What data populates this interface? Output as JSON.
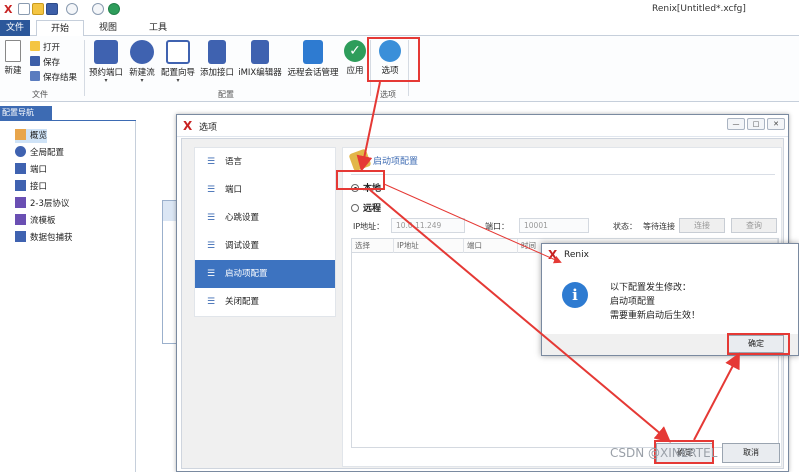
{
  "window": {
    "title": "Renix[Untitled*.xcfg]"
  },
  "ribbon_tabs": [
    "文件",
    "开始",
    "视图",
    "工具"
  ],
  "ribbon": {
    "new_label": "新建",
    "open_label": "打开",
    "save_label": "保存",
    "save_result_label": "保存结果",
    "file_group": "文件",
    "reserve_port": "预约端口",
    "new_flow": "新建流",
    "config_wizard": "配置向导",
    "add_interface": "添加接口",
    "imix_editor": "iMIX编辑器",
    "remote_session": "远程会话管理",
    "apply": "应用",
    "config_group": "配置",
    "options_btn": "选项",
    "options_group": "选项"
  },
  "nav": {
    "header": "配置导航",
    "items": [
      "概览",
      "全局配置",
      "端口",
      "接口",
      "2-3层协议",
      "流模板",
      "数据包捕获"
    ]
  },
  "options_dialog": {
    "title": "选项",
    "list": [
      "语言",
      "端口",
      "心跳设置",
      "调试设置",
      "启动项配置",
      "关闭配置"
    ],
    "panel_title": "启动项配置",
    "radio_local": "本地",
    "radio_remote": "远程",
    "ip_label": "IP地址：",
    "ip_value": "10.0.11.249",
    "port_label": "端口：",
    "port_value": "10001",
    "status_label": "状态：",
    "status_value": "等待连接",
    "connect_btn": "连接",
    "query_btn": "查询",
    "table_headers": [
      "选择",
      "IP地址",
      "端口",
      "时间"
    ],
    "ok_btn": "确定",
    "cancel_btn": "取消"
  },
  "renix_popup": {
    "title": "Renix",
    "icon": "info-icon",
    "line1": "以下配置发生修改：",
    "line2": "启动项配置",
    "line3": "需要重新启动后生效！",
    "ok_btn": "确定"
  },
  "watermark": "CSDN @XINERTEL",
  "colors": {
    "accent": "#3d73c0",
    "annotation": "#e53935"
  }
}
